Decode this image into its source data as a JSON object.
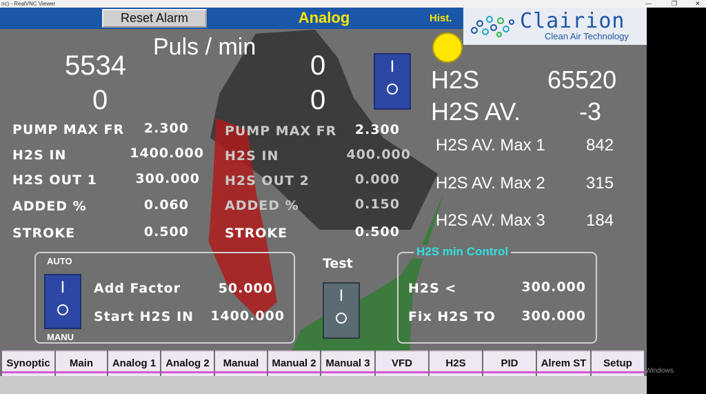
{
  "window": {
    "title": "nc) - RealVNC Viewer",
    "controls": [
      "—",
      "❐",
      "✕"
    ]
  },
  "header": {
    "reset_label": "Reset Alarm",
    "screen_title": "Analog",
    "hist_label": "Hist.",
    "logo_brand": "Clairion",
    "logo_tagline": "Clean Air Technology",
    "status_lamp_color": "#ffe600"
  },
  "pulses": {
    "title": "Puls / min",
    "left_top": "5534",
    "left_bottom": "0",
    "right_top": "0",
    "right_bottom": "0"
  },
  "switches": {
    "main": {
      "on": "I",
      "off": "O"
    },
    "auto_manu": {
      "top_label": "AUTO",
      "bottom_label": "MANU",
      "on": "I",
      "off": "O"
    },
    "test": {
      "label": "Test",
      "on": "I",
      "off": "O"
    }
  },
  "pump1": [
    {
      "label": "PUMP MAX FR",
      "value": "2.300"
    },
    {
      "label": "H2S IN",
      "value": "1400.000"
    },
    {
      "label": "H2S OUT 1",
      "value": "300.000"
    },
    {
      "label": "ADDED %",
      "value": "0.060"
    },
    {
      "label": "STROKE",
      "value": "0.500"
    }
  ],
  "pump2": [
    {
      "label": "PUMP MAX FR",
      "value": "2.300"
    },
    {
      "label": "H2S IN",
      "value": "400.000"
    },
    {
      "label": "H2S OUT 2",
      "value": "0.000"
    },
    {
      "label": "ADDED %",
      "value": "0.150"
    },
    {
      "label": "STROKE",
      "value": "0.500"
    }
  ],
  "h2s": {
    "label": "H2S",
    "value": "65520",
    "av_label": "H2S AV.",
    "av_value": "-3",
    "maxes": [
      {
        "label": "H2S AV. Max 1",
        "value": "842"
      },
      {
        "label": "H2S AV. Max 2",
        "value": "315"
      },
      {
        "label": "H2S AV. Max 3",
        "value": "184"
      }
    ]
  },
  "factor_panel": {
    "add_factor_label": "Add Factor",
    "add_factor_value": "50.000",
    "start_h2s_label": "Start H2S IN",
    "start_h2s_value": "1400.000"
  },
  "min_control": {
    "title": "H2S min Control",
    "h2s_lt_label": "H2S <",
    "h2s_lt_value": "300.000",
    "fix_label": "Fix H2S TO",
    "fix_value": "300.000"
  },
  "tabs": [
    "Synoptic",
    "Main",
    "Analog 1",
    "Analog 2",
    "Manual",
    "Manual 2",
    "Manual 3",
    "VFD",
    "H2S",
    "PID",
    "Alrem ST",
    "Setup"
  ],
  "watermark": "Windows."
}
